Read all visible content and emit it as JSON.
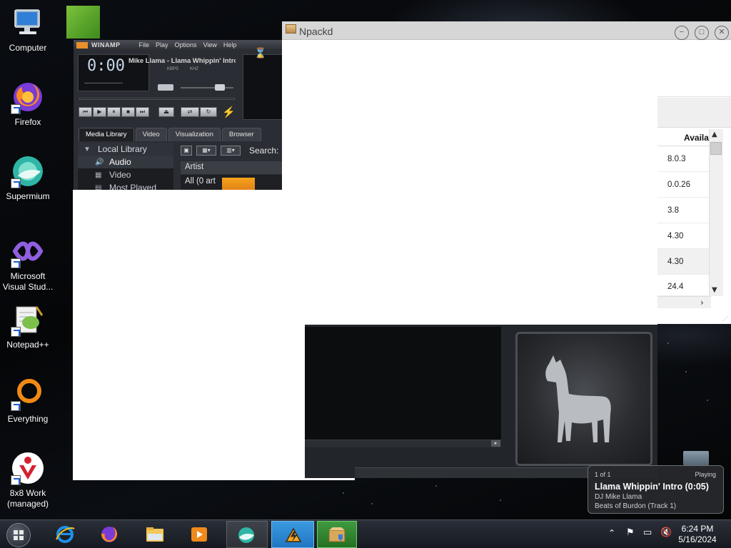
{
  "desktop": {
    "icons": [
      {
        "label": "Computer",
        "icon": "computer-icon"
      },
      {
        "label": "Firefox",
        "icon": "firefox-icon"
      },
      {
        "label": "Supermium",
        "icon": "supermium-icon"
      },
      {
        "label": "Microsoft Visual Stud...",
        "icon": "visual-studio-icon"
      },
      {
        "label": "Notepad++",
        "icon": "notepadpp-icon"
      },
      {
        "label": "Everything",
        "icon": "everything-icon"
      },
      {
        "label": "8x8 Work (managed)",
        "icon": "8x8-work-icon"
      }
    ]
  },
  "winamp": {
    "brand": "WINAMP",
    "menu": [
      "File",
      "Play",
      "Options",
      "View",
      "Help"
    ],
    "time": "0:00",
    "dashes": "------------------",
    "track": "Mike Llama - Llama Whippin' Intro",
    "kbps": "KBPS",
    "khz": "KHZ",
    "tabs": [
      "Media Library",
      "Video",
      "Visualization",
      "Browser"
    ],
    "tree": {
      "root": "Local Library",
      "items": [
        "Audio",
        "Video",
        "Most Played"
      ]
    },
    "search_label": "Search:",
    "column_artist": "Artist",
    "artist_row": "All (0 art"
  },
  "npackd": {
    "title": "Npackd",
    "column_header": "Available",
    "versions": [
      "8.0.3",
      "0.0.26",
      "3.8",
      "4.30",
      "4.30",
      "24.4"
    ]
  },
  "notification": {
    "count": "1 of 1",
    "status": "Playing",
    "title": "Llama Whippin' Intro (0:05)",
    "artist": "DJ Mike Llama",
    "album": "Beats of Burdon (Track 1)"
  },
  "taskbar": {
    "apps": [
      "internet-explorer-icon",
      "firefox-icon",
      "file-explorer-icon",
      "media-player-icon",
      "supermium-icon",
      "winamp-icon",
      "npackd-icon"
    ],
    "clock_time": "6:24 PM",
    "clock_date": "5/16/2024"
  },
  "colors": {
    "taskbar_active": "#2176c2",
    "taskbar_active_green": "#247024",
    "winamp_bg": "#2a2d33"
  }
}
